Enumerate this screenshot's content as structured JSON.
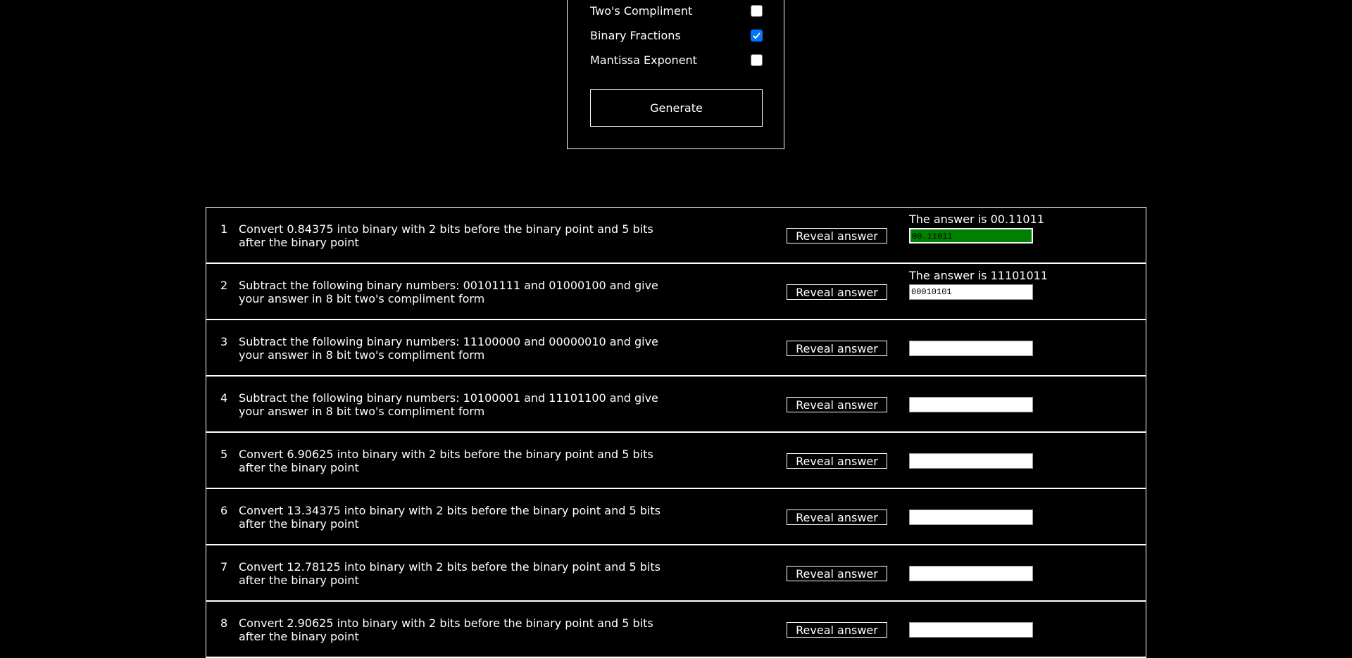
{
  "options": [
    {
      "label": "Two's Compliment",
      "checked": false
    },
    {
      "label": "Binary Fractions",
      "checked": true
    },
    {
      "label": "Mantissa Exponent",
      "checked": false
    }
  ],
  "generate_label": "Generate",
  "reveal_label": "Reveal answer",
  "questions": [
    {
      "num": "1",
      "text": "Convert 0.84375 into binary with 2 bits before the binary point and 5 bits after the binary point",
      "answer_label": "The answer is 00.11011",
      "input_value": "00.11011",
      "status": "correct"
    },
    {
      "num": "2",
      "text": "Subtract the following binary numbers: 00101111 and 01000100 and give your answer in 8 bit two's compliment form",
      "answer_label": "The answer is 11101011",
      "input_value": "00010101",
      "status": "incorrect"
    },
    {
      "num": "3",
      "text": "Subtract the following binary numbers: 11100000 and 00000010 and give your answer in 8 bit two's compliment form",
      "answer_label": "",
      "input_value": "",
      "status": "none"
    },
    {
      "num": "4",
      "text": "Subtract the following binary numbers: 10100001 and 11101100 and give your answer in 8 bit two's compliment form",
      "answer_label": "",
      "input_value": "",
      "status": "none"
    },
    {
      "num": "5",
      "text": "Convert 6.90625 into binary with 2 bits before the binary point and 5 bits after the binary point",
      "answer_label": "",
      "input_value": "",
      "status": "none"
    },
    {
      "num": "6",
      "text": "Convert 13.34375 into binary with 2 bits before the binary point and 5 bits after the binary point",
      "answer_label": "",
      "input_value": "",
      "status": "none"
    },
    {
      "num": "7",
      "text": "Convert 12.78125 into binary with 2 bits before the binary point and 5 bits after the binary point",
      "answer_label": "",
      "input_value": "",
      "status": "none"
    },
    {
      "num": "8",
      "text": "Convert 2.90625 into binary with 2 bits before the binary point and 5 bits after the binary point",
      "answer_label": "",
      "input_value": "",
      "status": "none"
    }
  ]
}
